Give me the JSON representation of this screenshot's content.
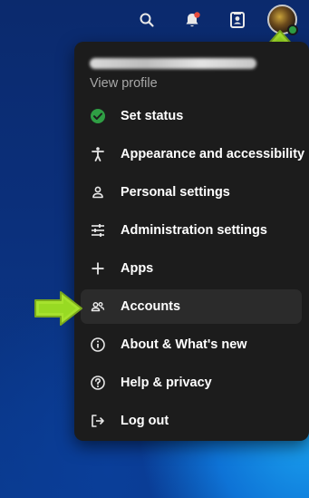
{
  "header": {
    "icons": [
      "search-icon",
      "notifications-icon",
      "contacts-icon"
    ],
    "notification_dot_color": "#e74c3c"
  },
  "user_menu": {
    "profile_link": "View profile",
    "items": [
      {
        "label": "Set status",
        "icon": "check-circle-icon"
      },
      {
        "label": "Appearance and accessibility",
        "icon": "accessibility-icon"
      },
      {
        "label": "Personal settings",
        "icon": "person-icon"
      },
      {
        "label": "Administration settings",
        "icon": "sliders-icon"
      },
      {
        "label": "Apps",
        "icon": "plus-icon"
      },
      {
        "label": "Accounts",
        "icon": "accounts-icon"
      },
      {
        "label": "About & What's new",
        "icon": "info-icon"
      },
      {
        "label": "Help & privacy",
        "icon": "help-icon"
      },
      {
        "label": "Log out",
        "icon": "logout-icon"
      }
    ]
  },
  "colors": {
    "menu_bg": "#1c1c1c",
    "status_green": "#2f9e44",
    "hint_arrow": "#a6e22e"
  }
}
